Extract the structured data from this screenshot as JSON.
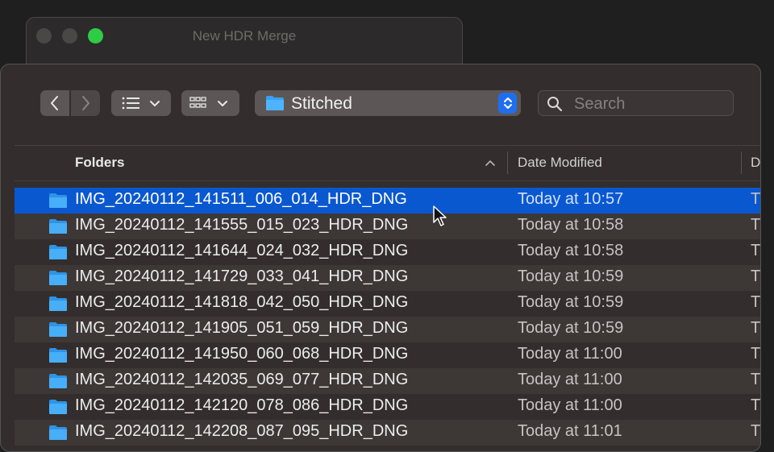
{
  "back_window": {
    "title": "New HDR Merge"
  },
  "toolbar": {
    "path_label": "Stitched",
    "search_placeholder": "Search"
  },
  "columns": {
    "name": "Folders",
    "date": "Date Modified",
    "third": "D"
  },
  "rows": [
    {
      "name": "IMG_20240112_141511_006_014_HDR_DNG",
      "date": "Today at 10:57",
      "third": "T",
      "selected": true
    },
    {
      "name": "IMG_20240112_141555_015_023_HDR_DNG",
      "date": "Today at 10:58",
      "third": "T"
    },
    {
      "name": "IMG_20240112_141644_024_032_HDR_DNG",
      "date": "Today at 10:58",
      "third": "T"
    },
    {
      "name": "IMG_20240112_141729_033_041_HDR_DNG",
      "date": "Today at 10:59",
      "third": "T"
    },
    {
      "name": "IMG_20240112_141818_042_050_HDR_DNG",
      "date": "Today at 10:59",
      "third": "T"
    },
    {
      "name": "IMG_20240112_141905_051_059_HDR_DNG",
      "date": "Today at 10:59",
      "third": "T"
    },
    {
      "name": "IMG_20240112_141950_060_068_HDR_DNG",
      "date": "Today at 11:00",
      "third": "T"
    },
    {
      "name": "IMG_20240112_142035_069_077_HDR_DNG",
      "date": "Today at 11:00",
      "third": "T"
    },
    {
      "name": "IMG_20240112_142120_078_086_HDR_DNG",
      "date": "Today at 11:00",
      "third": "T"
    },
    {
      "name": "IMG_20240112_142208_087_095_HDR_DNG",
      "date": "Today at 11:01",
      "third": "T"
    }
  ],
  "colors": {
    "selection": "#0a58d0",
    "folder_icon": "#3aa0f0",
    "accent": "#1f6ef0"
  }
}
